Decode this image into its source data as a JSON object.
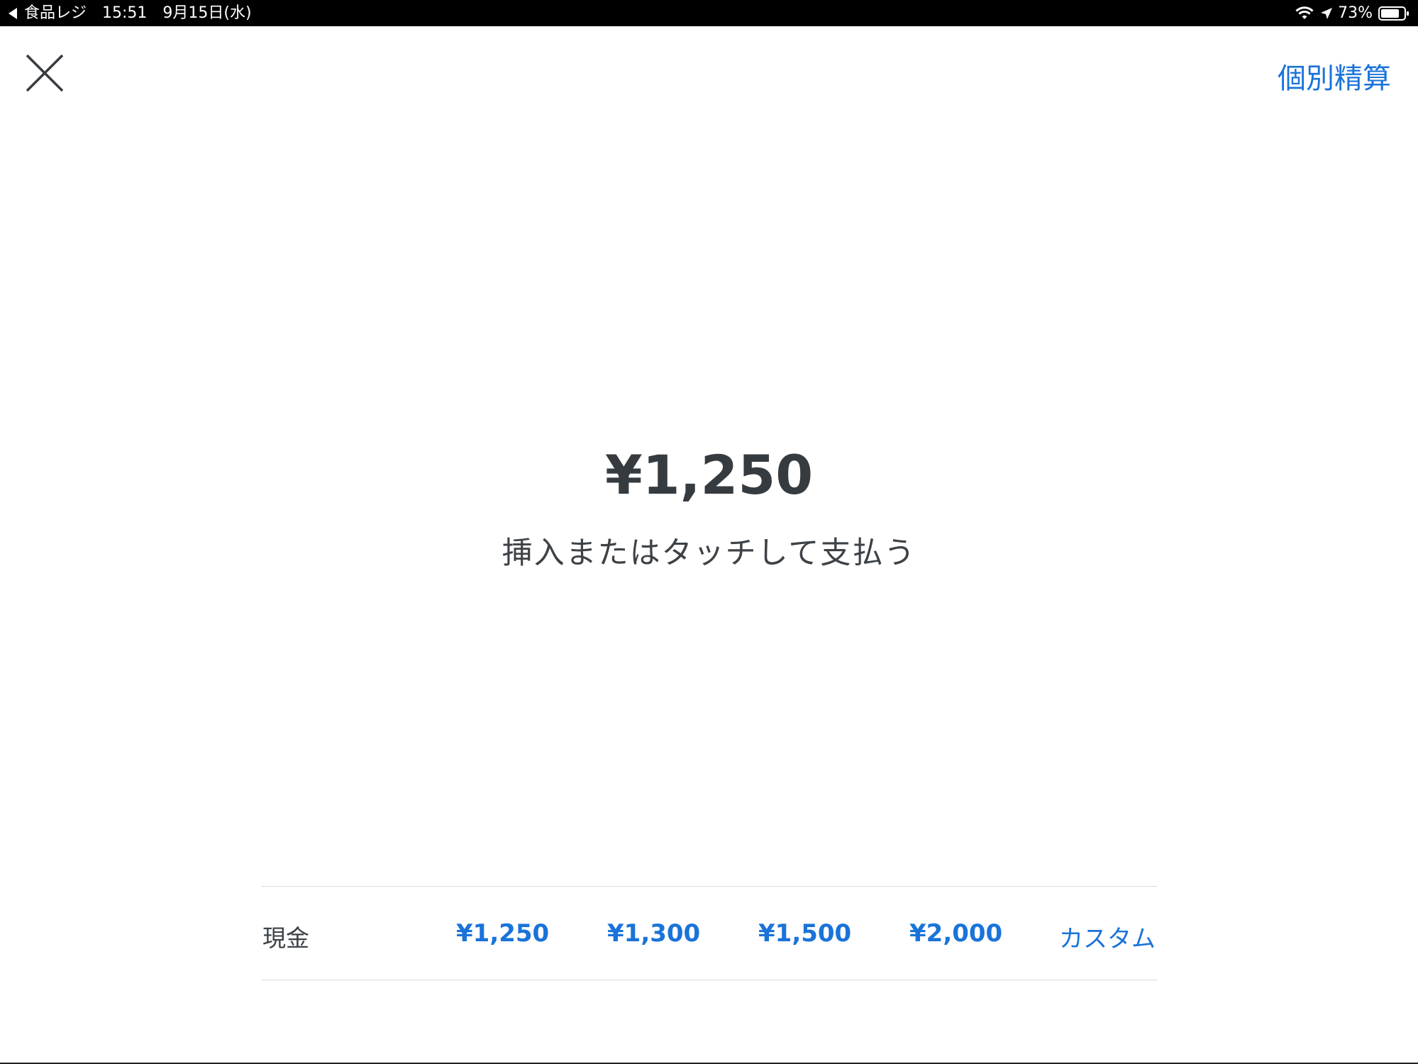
{
  "status_bar": {
    "app_name": "食品レジ",
    "time": "15:51",
    "date": "9月15日(水)",
    "battery_percent": "73%"
  },
  "header": {
    "split_label": "個別精算"
  },
  "payment": {
    "amount": "¥1,250",
    "prompt": "挿入またはタッチして支払う"
  },
  "cash": {
    "label": "現金",
    "options": [
      "¥1,250",
      "¥1,300",
      "¥1,500",
      "¥2,000"
    ],
    "custom_label": "カスタム"
  },
  "colors": {
    "accent": "#1a73d9",
    "text": "#363b40"
  }
}
